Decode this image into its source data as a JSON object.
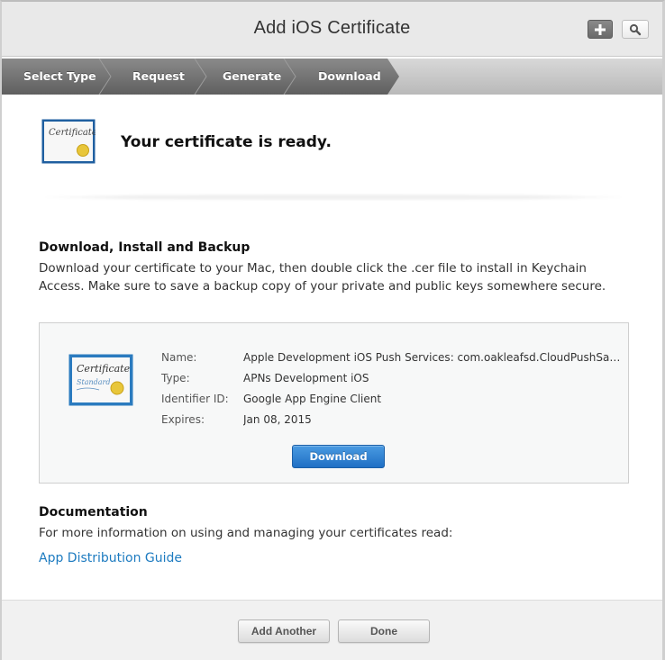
{
  "header": {
    "title": "Add iOS Certificate",
    "add_icon": "plus-icon",
    "search_icon": "search-icon"
  },
  "breadcrumb": {
    "steps": [
      {
        "label": "Select Type"
      },
      {
        "label": "Request"
      },
      {
        "label": "Generate"
      },
      {
        "label": "Download",
        "current": true
      }
    ]
  },
  "status": {
    "icon": "certificate-icon",
    "title": "Your certificate is ready."
  },
  "install_section": {
    "heading": "Download, Install and Backup",
    "line1": "Download your certificate to your Mac, then double click the .cer file to install in Keychain",
    "line2": "Access. Make sure to save a backup copy of your private and public keys somewhere secure."
  },
  "certificate": {
    "icon": "certificate-standard-icon",
    "fields": [
      {
        "label": "Name:",
        "value": "Apple Development iOS Push Services: com.oakleafsd.CloudPushSam..."
      },
      {
        "label": "Type:",
        "value": "APNs Development iOS"
      },
      {
        "label": "Identifier ID:",
        "value": "Google App Engine Client"
      },
      {
        "label": "Expires:",
        "value": "Jan 08, 2015"
      }
    ],
    "download_label": "Download"
  },
  "documentation": {
    "heading": "Documentation",
    "text": "For more information on using and managing your certificates read:",
    "link_label": "App Distribution Guide"
  },
  "footer": {
    "add_another_label": "Add Another",
    "done_label": "Done"
  },
  "colors": {
    "accent_blue": "#1f6fc4",
    "link_blue": "#1d7bc0",
    "breadcrumb_dark": "#6f6f6f"
  }
}
